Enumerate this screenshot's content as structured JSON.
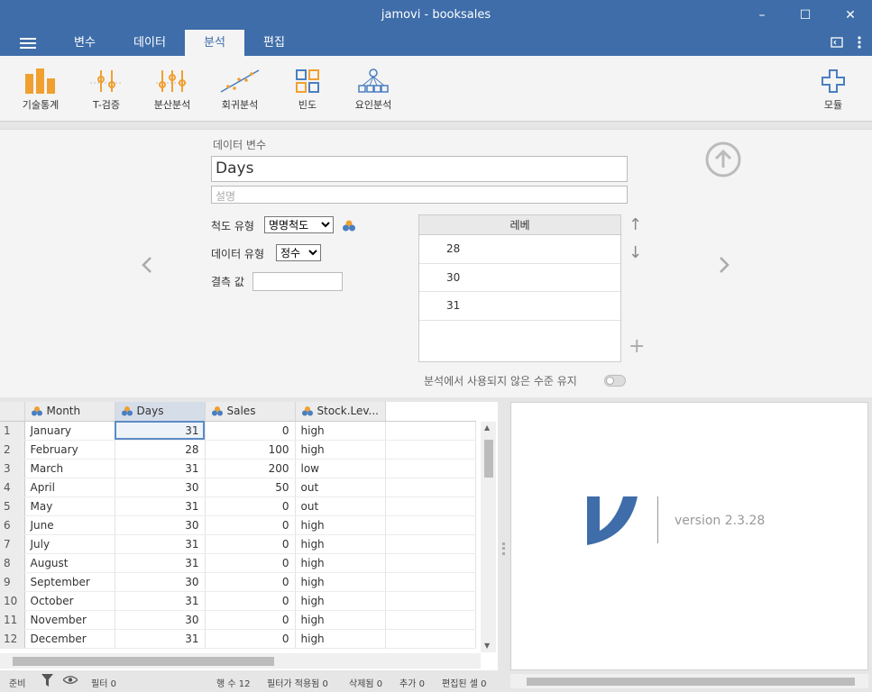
{
  "window": {
    "title": "jamovi - booksales",
    "controls": {
      "minimize": "–",
      "maximize": "☐",
      "close": "✕"
    }
  },
  "tabs": [
    {
      "label": "변수",
      "active": false
    },
    {
      "label": "데이터",
      "active": false
    },
    {
      "label": "분석",
      "active": true
    },
    {
      "label": "편집",
      "active": false
    }
  ],
  "ribbon": {
    "buttons": [
      {
        "label": "기술통계",
        "icon": "bar-chart-icon"
      },
      {
        "label": "T-검증",
        "icon": "t-test-icon"
      },
      {
        "label": "분산분석",
        "icon": "anova-icon"
      },
      {
        "label": "회귀분석",
        "icon": "regression-icon"
      },
      {
        "label": "빈도",
        "icon": "frequencies-icon"
      },
      {
        "label": "요인분석",
        "icon": "factor-icon"
      }
    ],
    "modules_label": "모듈"
  },
  "editor": {
    "section_label": "데이터 변수",
    "variable_name": "Days",
    "description_placeholder": "설명",
    "measure_type_label": "척도 유형",
    "measure_type_value": "명명척도",
    "data_type_label": "데이터 유형",
    "data_type_value": "정수",
    "missing_label": "결측 값",
    "levels_header": "레베",
    "levels": [
      "28",
      "30",
      "31"
    ],
    "retain_unused_label": "분석에서 사용되지 않은 수준 유지"
  },
  "sheet": {
    "columns": [
      "Month",
      "Days",
      "Sales",
      "Stock.Lev..."
    ],
    "rows": [
      {
        "n": "1",
        "month": "January",
        "days": "31",
        "sales": "0",
        "stock": "high"
      },
      {
        "n": "2",
        "month": "February",
        "days": "28",
        "sales": "100",
        "stock": "high"
      },
      {
        "n": "3",
        "month": "March",
        "days": "31",
        "sales": "200",
        "stock": "low"
      },
      {
        "n": "4",
        "month": "April",
        "days": "30",
        "sales": "50",
        "stock": "out"
      },
      {
        "n": "5",
        "month": "May",
        "days": "31",
        "sales": "0",
        "stock": "out"
      },
      {
        "n": "6",
        "month": "June",
        "days": "30",
        "sales": "0",
        "stock": "high"
      },
      {
        "n": "7",
        "month": "July",
        "days": "31",
        "sales": "0",
        "stock": "high"
      },
      {
        "n": "8",
        "month": "August",
        "days": "31",
        "sales": "0",
        "stock": "high"
      },
      {
        "n": "9",
        "month": "September",
        "days": "30",
        "sales": "0",
        "stock": "high"
      },
      {
        "n": "10",
        "month": "October",
        "days": "31",
        "sales": "0",
        "stock": "high"
      },
      {
        "n": "11",
        "month": "November",
        "days": "30",
        "sales": "0",
        "stock": "high"
      },
      {
        "n": "12",
        "month": "December",
        "days": "31",
        "sales": "0",
        "stock": "high"
      }
    ]
  },
  "results": {
    "version": "version 2.3.28"
  },
  "status": {
    "ready": "준비",
    "filter": "필터 0",
    "row_count": "행 수 12",
    "filtered": "필터가 적용됨 0",
    "deleted": "삭제됨 0",
    "added": "추가 0",
    "edited": "편집된 셀 0"
  },
  "colors": {
    "brand": "#3e6da9",
    "icon_orange": "#f0a030",
    "icon_blue": "#4a7fc0"
  }
}
